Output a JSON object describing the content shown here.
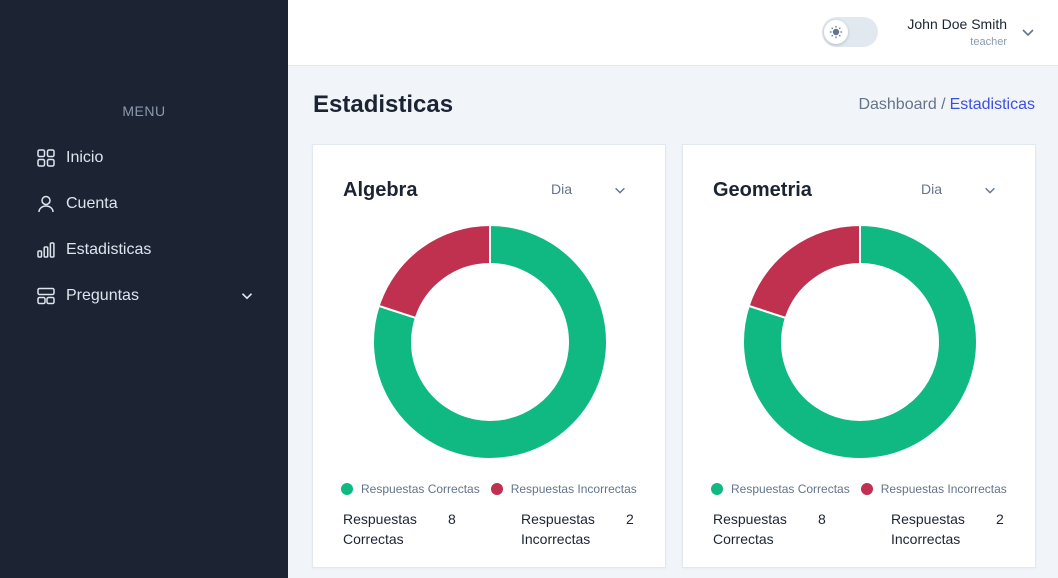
{
  "sidebar": {
    "menu_title": "MENU",
    "items": [
      {
        "label": "Inicio",
        "icon": "grid-icon"
      },
      {
        "label": "Cuenta",
        "icon": "user-icon"
      },
      {
        "label": "Estadisticas",
        "icon": "bar-chart-icon"
      },
      {
        "label": "Preguntas",
        "icon": "layout-icon",
        "expandable": true
      }
    ]
  },
  "header": {
    "theme_toggle": {
      "icon": "sun-icon",
      "dark_mode": false
    },
    "user": {
      "name": "John Doe Smith",
      "role": "teacher"
    }
  },
  "page": {
    "title": "Estadisticas",
    "breadcrumb": {
      "parent": "Dashboard /",
      "current": "Estadisticas"
    }
  },
  "colors": {
    "correct": "#10b981",
    "incorrect": "#c0304f",
    "accent": "#3c50e0"
  },
  "cards": [
    {
      "title": "Algebra",
      "period": "Dia",
      "legend": {
        "correct": "Respuestas Correctas",
        "incorrect": "Respuestas Incorrectas"
      },
      "stats": {
        "correct_label": "Respuestas Correctas",
        "correct_value": "8",
        "incorrect_label": "Respuestas Incorrectas",
        "incorrect_value": "2"
      }
    },
    {
      "title": "Geometria",
      "period": "Dia",
      "legend": {
        "correct": "Respuestas Correctas",
        "incorrect": "Respuestas Incorrectas"
      },
      "stats": {
        "correct_label": "Respuestas Correctas",
        "correct_value": "8",
        "incorrect_label": "Respuestas Incorrectas",
        "incorrect_value": "2"
      }
    }
  ],
  "chart_data": [
    {
      "type": "pie",
      "categories": [
        "Respuestas Correctas",
        "Respuestas Incorrectas"
      ],
      "values": [
        8,
        2
      ],
      "donut": true,
      "legend": "bottom"
    },
    {
      "type": "pie",
      "categories": [
        "Respuestas Correctas",
        "Respuestas Incorrectas"
      ],
      "values": [
        8,
        2
      ],
      "donut": true,
      "legend": "bottom"
    }
  ]
}
